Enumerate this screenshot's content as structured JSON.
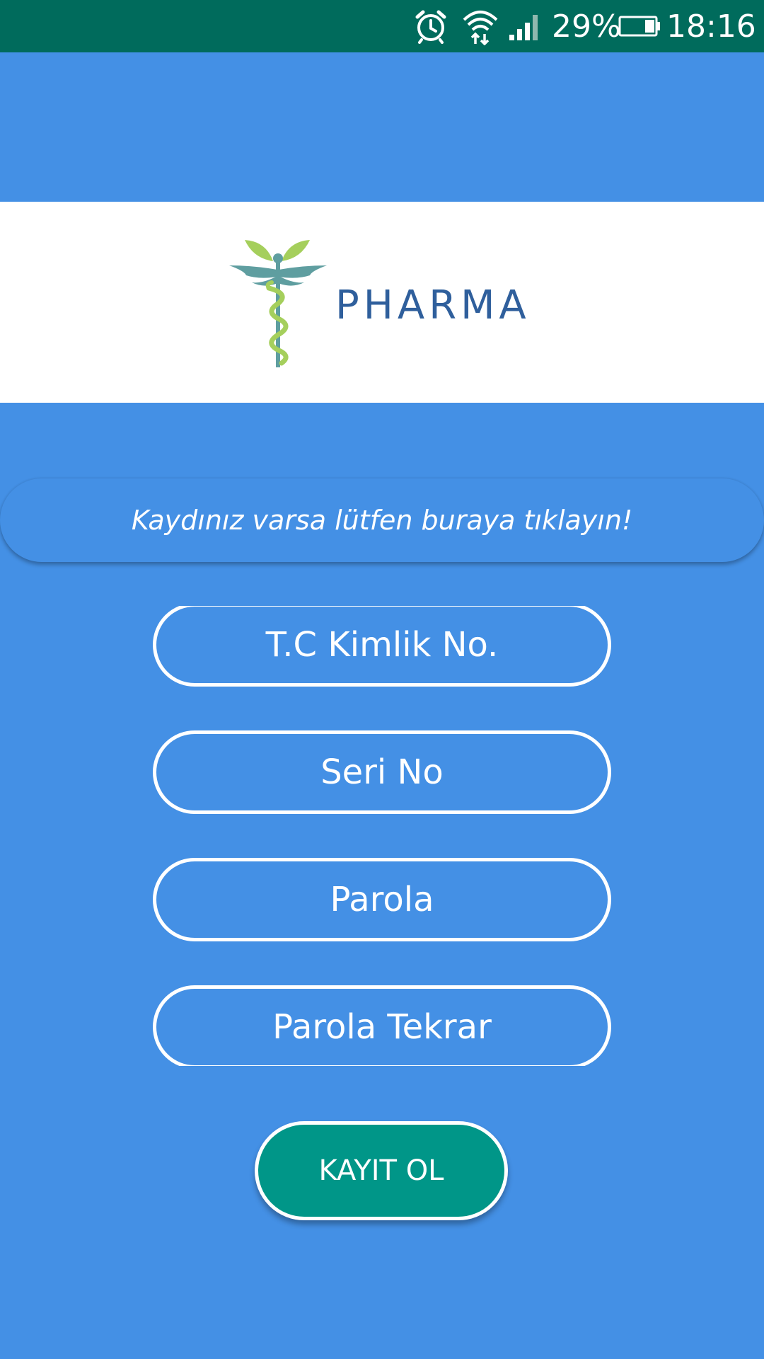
{
  "status_bar": {
    "battery_percent": "29%",
    "time": "18:16",
    "icons": [
      "alarm-icon",
      "wifi-icon",
      "signal-icon",
      "battery-icon"
    ],
    "background_color": "#006b5c"
  },
  "logo": {
    "text": "PHARMA",
    "icon": "caduceus-icon",
    "text_color": "#2f5f9c",
    "leaf_color": "#a5cf5c",
    "wing_color": "#5f9ea0"
  },
  "login_link": {
    "label": "Kaydınız varsa lütfen buraya tıklayın!"
  },
  "form": {
    "tc_kimlik_placeholder": "T.C Kimlik No.",
    "seri_no_placeholder": "Seri No",
    "parola_placeholder": "Parola",
    "parola_tekrar_placeholder": "Parola Tekrar"
  },
  "register_button": {
    "label": "KAYIT OL",
    "color": "#009688"
  },
  "theme": {
    "background": "#4490e5"
  }
}
